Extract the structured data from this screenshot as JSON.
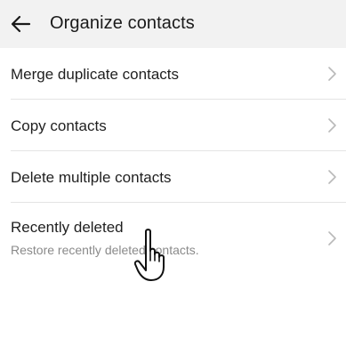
{
  "header": {
    "title": "Organize contacts",
    "back_icon": "arrow-left-icon",
    "background": "#f2f2f2"
  },
  "list": {
    "items": [
      {
        "label": "Merge duplicate contacts",
        "icon": "chevron-right-icon"
      },
      {
        "label": "Copy contacts",
        "icon": "chevron-right-icon"
      },
      {
        "label": "Delete multiple contacts",
        "icon": "chevron-right-icon"
      },
      {
        "label": "Recently deleted",
        "sublabel": "Restore recently deleted contacts.",
        "icon": "chevron-right-icon"
      }
    ]
  },
  "overlay": {
    "cursor_icon": "hand-pointer-icon"
  }
}
